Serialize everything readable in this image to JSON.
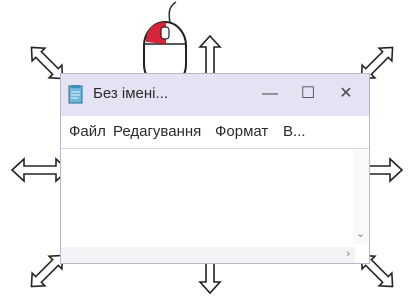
{
  "window": {
    "title": "Без імені...",
    "controls": {
      "minimize": "—",
      "maximize": "☐",
      "close": "✕"
    }
  },
  "menubar": {
    "items": [
      {
        "label": "Файл"
      },
      {
        "label": "Редагування"
      },
      {
        "label": "Формат"
      },
      {
        "label": "В..."
      }
    ]
  },
  "scrollbars": {
    "down_glyph": "⌄",
    "right_glyph": "›"
  },
  "icons": [
    "notepad-icon",
    "mouse-icon",
    "resize-arrow-icon"
  ]
}
